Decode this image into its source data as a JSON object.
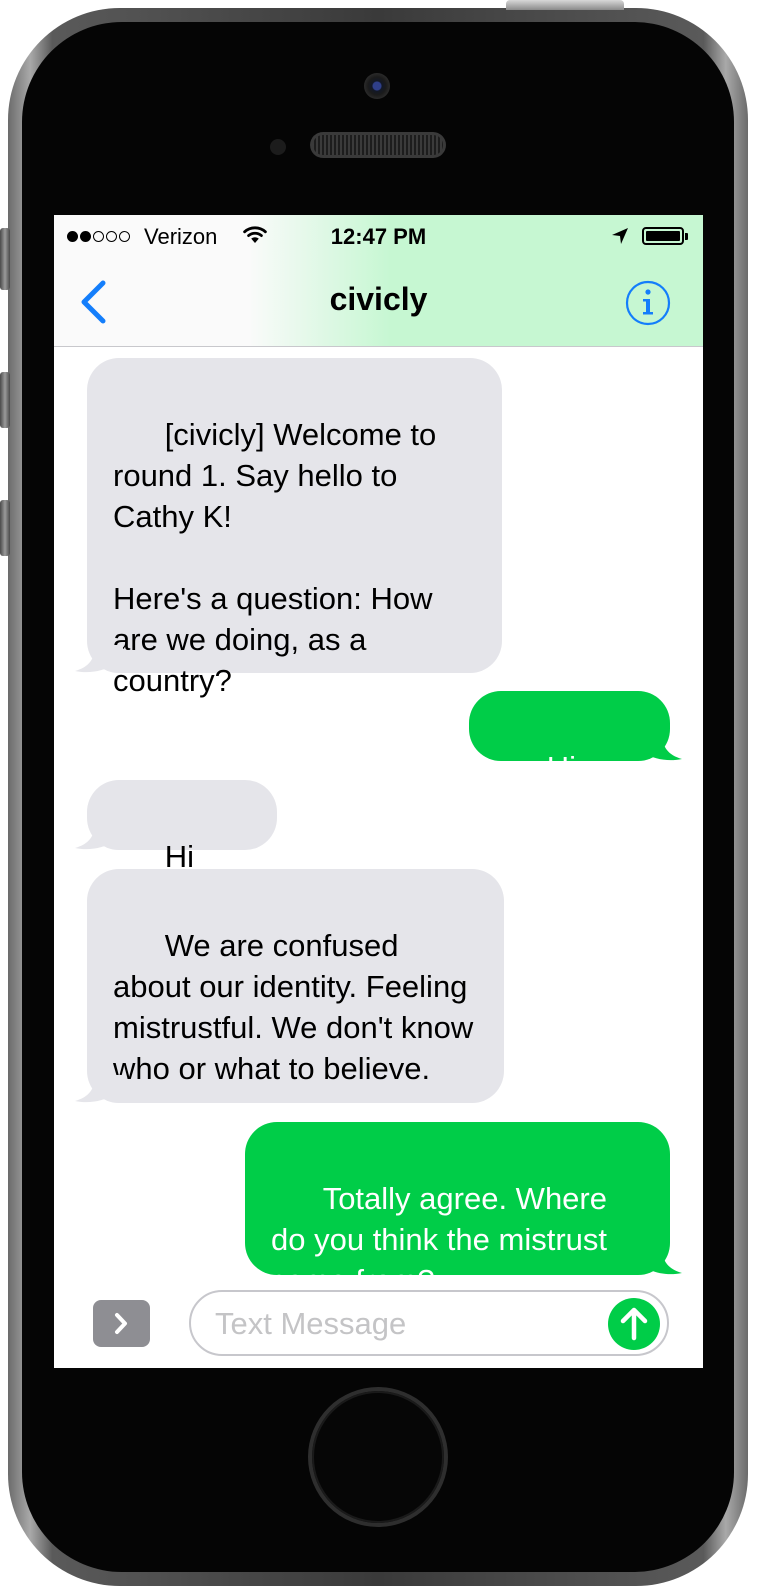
{
  "status_bar": {
    "carrier": "Verizon",
    "time": "12:47 PM",
    "signal_bars_filled": 2,
    "signal_bars_total": 5
  },
  "nav": {
    "title": "civicly",
    "back_icon": "chevron-left-icon",
    "info_icon": "info-icon"
  },
  "messages": [
    {
      "direction": "incoming",
      "text": "[civicly] Welcome to round 1. Say hello to Cathy K!\n\nHere's a question: How are we doing, as a country?"
    },
    {
      "direction": "outgoing",
      "text": "Hi, Cathy!"
    },
    {
      "direction": "incoming",
      "text": "Hi Ben S!"
    },
    {
      "direction": "incoming",
      "text": "We are confused about our identity. Feeling mistrustful. We don't know who or what to believe."
    },
    {
      "direction": "outgoing",
      "text": "Totally agree. Where do you think the mistrust came from?"
    }
  ],
  "input": {
    "placeholder": "Text Message",
    "value": ""
  },
  "colors": {
    "incoming_bubble": "#e5e5ea",
    "outgoing_bubble": "#00cd48",
    "accent": "#147efb",
    "header_tint": "#c6f7d2"
  }
}
